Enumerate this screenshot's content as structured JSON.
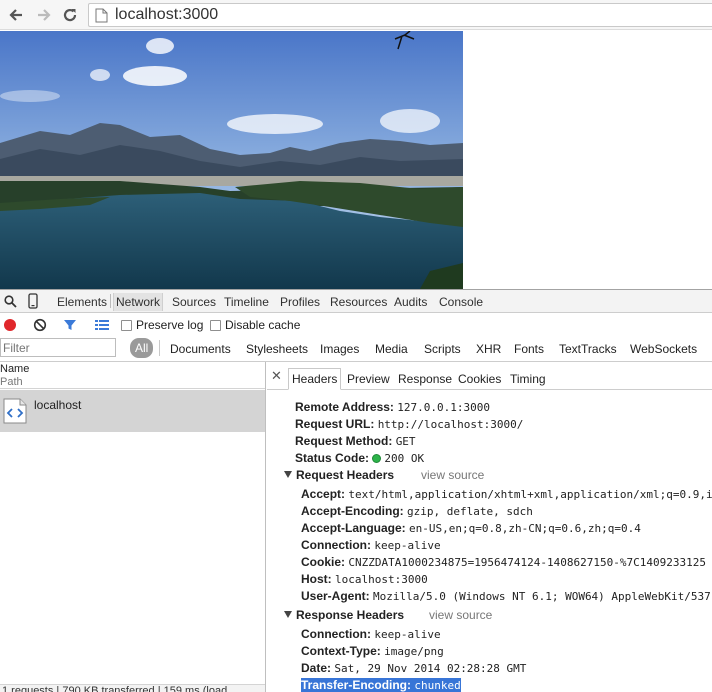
{
  "browser": {
    "url": "localhost:3000"
  },
  "devtools": {
    "tabs": [
      "Elements",
      "Network",
      "Sources",
      "Timeline",
      "Profiles",
      "Resources",
      "Audits",
      "Console"
    ],
    "active_tab": "Network",
    "controls": {
      "preserve_log": "Preserve log",
      "disable_cache": "Disable cache"
    },
    "filter": {
      "placeholder": "Filter",
      "types": [
        "All",
        "Documents",
        "Stylesheets",
        "Images",
        "Media",
        "Scripts",
        "XHR",
        "Fonts",
        "TextTracks",
        "WebSockets"
      ]
    },
    "request_list": {
      "col_name": "Name",
      "col_path": "Path",
      "items": [
        {
          "name": "localhost"
        }
      ],
      "status_bar": "1 requests  |  790 KB transferred  |  159 ms (load"
    },
    "details": {
      "tabs": [
        "Headers",
        "Preview",
        "Response",
        "Cookies",
        "Timing"
      ],
      "active_tab": "Headers",
      "general": [
        {
          "key": "Remote Address:",
          "value": "127.0.0.1:3000"
        },
        {
          "key": "Request URL:",
          "value": "http://localhost:3000/"
        },
        {
          "key": "Request Method:",
          "value": "GET"
        },
        {
          "key": "Status Code:",
          "value": "200 OK"
        }
      ],
      "request_headers": {
        "title": "Request Headers",
        "view_source": "view source",
        "items": [
          {
            "key": "Accept:",
            "value": "text/html,application/xhtml+xml,application/xml;q=0.9,i"
          },
          {
            "key": "Accept-Encoding:",
            "value": "gzip, deflate, sdch"
          },
          {
            "key": "Accept-Language:",
            "value": "en-US,en;q=0.8,zh-CN;q=0.6,zh;q=0.4"
          },
          {
            "key": "Connection:",
            "value": "keep-alive"
          },
          {
            "key": "Cookie:",
            "value": "CNZZDATA1000234875=1956474124-1408627150-%7C1409233125"
          },
          {
            "key": "Host:",
            "value": "localhost:3000"
          },
          {
            "key": "User-Agent:",
            "value": "Mozilla/5.0 (Windows NT 6.1; WOW64) AppleWebKit/537"
          }
        ]
      },
      "response_headers": {
        "title": "Response Headers",
        "view_source": "view source",
        "items": [
          {
            "key": "Connection:",
            "value": "keep-alive"
          },
          {
            "key": "Context-Type:",
            "value": "image/png"
          },
          {
            "key": "Date:",
            "value": "Sat, 29 Nov 2014 02:28:28 GMT"
          },
          {
            "key": "Transfer-Encoding:",
            "value": "chunked"
          }
        ]
      }
    }
  }
}
